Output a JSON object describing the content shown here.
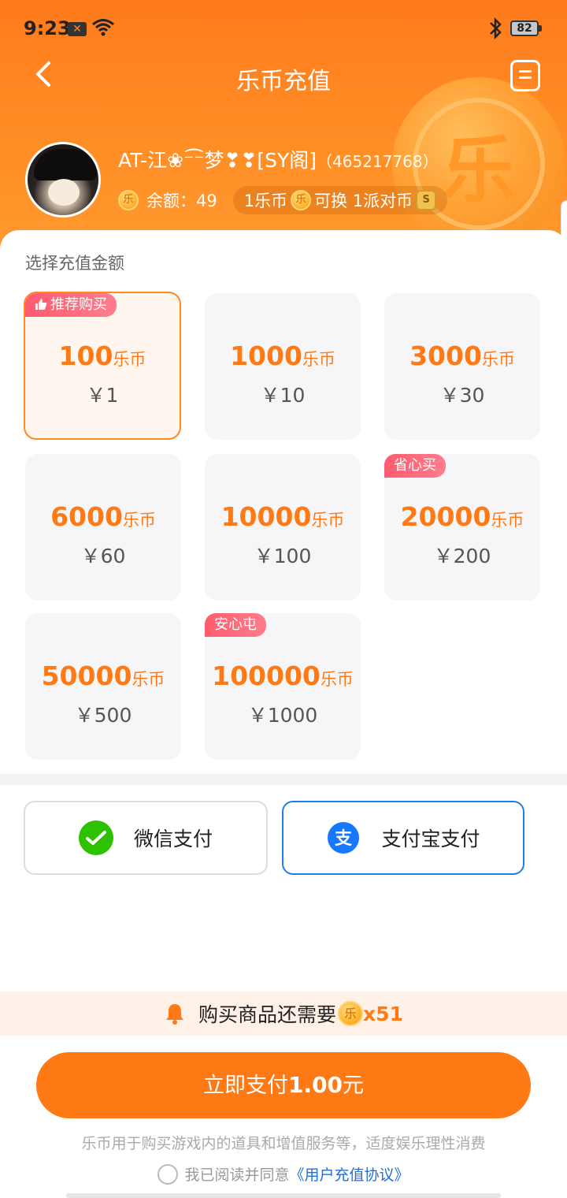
{
  "status": {
    "time": "9:23",
    "notif_icon": "x-notification-icon",
    "battery": "82"
  },
  "nav": {
    "title": "乐币充值"
  },
  "user": {
    "name": "AT-江❀⁻͡͡⁻梦❣❣[SY阁]",
    "uid": "（465217768）",
    "coin_symbol": "乐",
    "balance_label": "余额：49",
    "rate_prefix": "1乐币",
    "rate_suffix": "可换 1派对币",
    "party_symbol": "S"
  },
  "packages_section": {
    "label": "选择充值金额",
    "unit": "乐币",
    "items": [
      {
        "amount": "100",
        "price": "￥1",
        "tag": "推荐购买",
        "selected": true
      },
      {
        "amount": "1000",
        "price": "￥10",
        "tag": ""
      },
      {
        "amount": "3000",
        "price": "￥30",
        "tag": ""
      },
      {
        "amount": "6000",
        "price": "￥60",
        "tag": ""
      },
      {
        "amount": "10000",
        "price": "￥100",
        "tag": ""
      },
      {
        "amount": "20000",
        "price": "￥200",
        "tag": "省心买"
      },
      {
        "amount": "50000",
        "price": "￥500",
        "tag": ""
      },
      {
        "amount": "100000",
        "price": "￥1000",
        "tag": "安心屯"
      }
    ]
  },
  "payment": {
    "wechat_label": "微信支付",
    "alipay_label": "支付宝支付",
    "selected": "alipay"
  },
  "notice": {
    "text": "购买商品还需要",
    "need": "x51"
  },
  "pay_button": {
    "prefix": "立即支付",
    "amount": "1.00",
    "suffix": "元"
  },
  "footer": {
    "note": "乐币用于购买游戏内的道具和增值服务等，适度娱乐理性消费",
    "agree_text": "我已阅读并同意",
    "agreement_link": "《用户充值协议》"
  },
  "colors": {
    "accent": "#ff7a14",
    "alipay_blue": "#1f7ee8",
    "wechat_green": "#2dc100",
    "tag_pink": "#ff5b6e"
  }
}
